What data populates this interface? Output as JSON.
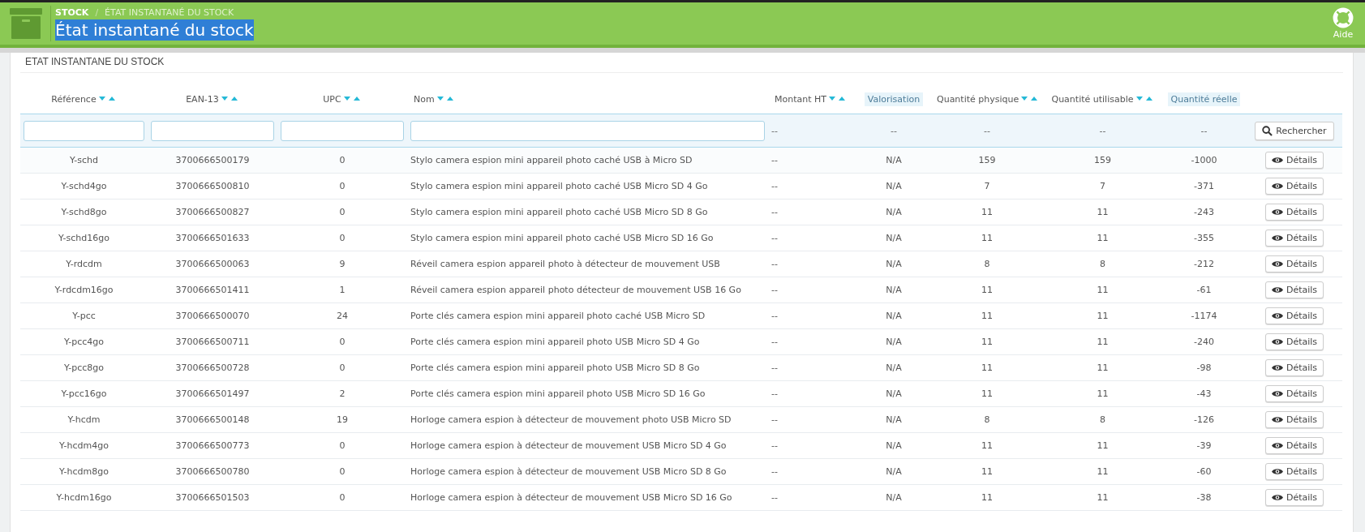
{
  "header": {
    "breadcrumb": [
      {
        "kind": "link",
        "text": "STOCK"
      },
      {
        "kind": "separator",
        "text": "/"
      },
      {
        "kind": "link",
        "text": "ÉTAT INSTANTANÉ DU STOCK"
      }
    ],
    "title": "État instantané du stock",
    "title_selected": true,
    "help": "Aide"
  },
  "panel": {
    "title": "ETAT INSTANTANE DU STOCK"
  },
  "table": {
    "columns": [
      {
        "label": "Référence",
        "sortable": true
      },
      {
        "label": "EAN-13",
        "sortable": true
      },
      {
        "label": "UPC",
        "sortable": true
      },
      {
        "label": "Nom",
        "sortable": true
      },
      {
        "label": "Montant HT",
        "sortable": true
      },
      {
        "label": "Valorisation",
        "sortable": false
      },
      {
        "label": "Quantité physique",
        "sortable": true
      },
      {
        "label": "Quantité utilisable",
        "sortable": true
      },
      {
        "label": "Quantité réelle",
        "sortable": false
      }
    ],
    "filters": [
      {
        "kind": "input"
      },
      {
        "kind": "input"
      },
      {
        "kind": "input"
      },
      {
        "kind": "input"
      },
      {
        "kind": "text",
        "text": "--"
      },
      {
        "kind": "text",
        "text": "--"
      },
      {
        "kind": "text",
        "text": "--"
      },
      {
        "kind": "text",
        "text": "--"
      },
      {
        "kind": "text",
        "text": "--"
      }
    ],
    "search_button": "Rechercher",
    "rows": [
      {
        "cells": [
          "Y-schd",
          "3700666500179",
          "0",
          "Stylo camera espion mini appareil photo caché USB à Micro SD",
          "--",
          "N/A",
          "159",
          "159",
          "-1000"
        ],
        "action": "Détails"
      },
      {
        "cells": [
          "Y-schd4go",
          "3700666500810",
          "0",
          "Stylo camera espion mini appareil photo caché USB Micro SD 4 Go",
          "--",
          "N/A",
          "7",
          "7",
          "-371"
        ],
        "action": "Détails"
      },
      {
        "cells": [
          "Y-schd8go",
          "3700666500827",
          "0",
          "Stylo camera espion mini appareil photo caché USB Micro SD 8 Go",
          "--",
          "N/A",
          "11",
          "11",
          "-243"
        ],
        "action": "Détails"
      },
      {
        "cells": [
          "Y-schd16go",
          "3700666501633",
          "0",
          "Stylo camera espion mini appareil photo caché USB Micro SD 16 Go",
          "--",
          "N/A",
          "11",
          "11",
          "-355"
        ],
        "action": "Détails"
      },
      {
        "cells": [
          "Y-rdcdm",
          "3700666500063",
          "9",
          "Réveil camera espion appareil photo à détecteur de mouvement USB",
          "--",
          "N/A",
          "8",
          "8",
          "-212"
        ],
        "action": "Détails"
      },
      {
        "cells": [
          "Y-rdcdm16go",
          "3700666501411",
          "1",
          "Réveil camera espion appareil photo détecteur de mouvement USB 16 Go",
          "--",
          "N/A",
          "11",
          "11",
          "-61"
        ],
        "action": "Détails"
      },
      {
        "cells": [
          "Y-pcc",
          "3700666500070",
          "24",
          "Porte clés camera espion mini appareil photo caché USB Micro SD",
          "--",
          "N/A",
          "11",
          "11",
          "-1174"
        ],
        "action": "Détails"
      },
      {
        "cells": [
          "Y-pcc4go",
          "3700666500711",
          "0",
          "Porte clés camera espion mini appareil photo USB Micro SD 4 Go",
          "--",
          "N/A",
          "11",
          "11",
          "-240"
        ],
        "action": "Détails"
      },
      {
        "cells": [
          "Y-pcc8go",
          "3700666500728",
          "0",
          "Porte clés camera espion mini appareil photo USB Micro SD 8 Go",
          "--",
          "N/A",
          "11",
          "11",
          "-98"
        ],
        "action": "Détails"
      },
      {
        "cells": [
          "Y-pcc16go",
          "3700666501497",
          "2",
          "Porte clés camera espion mini appareil photo USB Micro SD 16 Go",
          "--",
          "N/A",
          "11",
          "11",
          "-43"
        ],
        "action": "Détails"
      },
      {
        "cells": [
          "Y-hcdm",
          "3700666500148",
          "19",
          "Horloge camera espion à détecteur de mouvement photo USB Micro SD",
          "--",
          "N/A",
          "8",
          "8",
          "-126"
        ],
        "action": "Détails"
      },
      {
        "cells": [
          "Y-hcdm4go",
          "3700666500773",
          "0",
          "Horloge camera espion à détecteur de mouvement USB Micro SD 4 Go",
          "--",
          "N/A",
          "11",
          "11",
          "-39"
        ],
        "action": "Détails"
      },
      {
        "cells": [
          "Y-hcdm8go",
          "3700666500780",
          "0",
          "Horloge camera espion à détecteur de mouvement USB Micro SD 8 Go",
          "--",
          "N/A",
          "11",
          "11",
          "-60"
        ],
        "action": "Détails"
      },
      {
        "cells": [
          "Y-hcdm16go",
          "3700666501503",
          "0",
          "Horloge camera espion à détecteur de mouvement USB Micro SD 16 Go",
          "--",
          "N/A",
          "11",
          "11",
          "-38"
        ],
        "action": "Détails"
      }
    ]
  }
}
